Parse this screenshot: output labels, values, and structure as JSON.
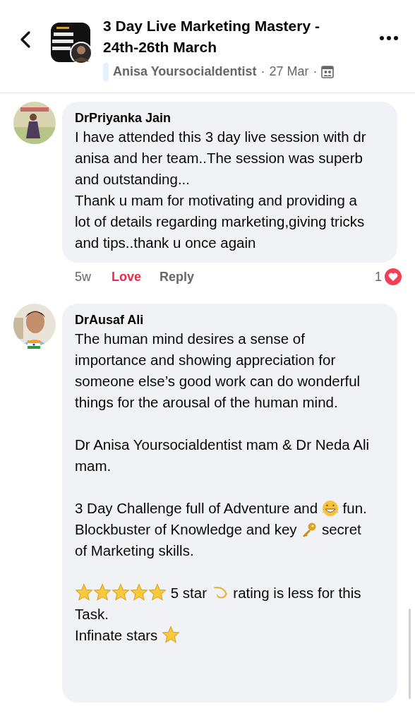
{
  "header": {
    "title": "3 Day Live Marketing Mastery - 24th-26th March",
    "author": "Anisa Yoursocialdentist",
    "date": "27 Mar",
    "separator": "·"
  },
  "comments": [
    {
      "name": "DrPriyanka Jain",
      "blocks": [
        [
          [
            {
              "kind": "text",
              "text": "I have attended this 3 day live session with dr anisa and her team..The session was superb and outstanding..."
            }
          ],
          [
            {
              "kind": "text",
              "text": "Thank u mam for motivating and providing a lot of details regarding marketing,giving tricks and tips..thank u once again"
            }
          ]
        ]
      ],
      "time": "5w",
      "love_label": "Love",
      "reacted": true,
      "reply_label": "Reply",
      "reaction_count": "1"
    },
    {
      "name": "DrAusaf Ali",
      "blocks": [
        [
          [
            {
              "kind": "text",
              "text": "The human mind desires a sense of importance and showing appreciation for someone else’s good work can do wonderful things for the arousal of the human mind."
            }
          ]
        ],
        [
          [
            {
              "kind": "text",
              "text": "Dr Anisa Yoursocialdentist mam & Dr Neda Ali mam."
            }
          ]
        ],
        [
          [
            {
              "kind": "text",
              "text": "3 Day Challenge full of Adventure and "
            },
            {
              "kind": "grin"
            },
            {
              "kind": "text",
              "text": " fun."
            }
          ],
          [
            {
              "kind": "text",
              "text": "Blockbuster of Knowledge and key "
            },
            {
              "kind": "key"
            },
            {
              "kind": "text",
              "text": " secret of Marketing skills."
            }
          ]
        ],
        [
          [
            {
              "kind": "star"
            },
            {
              "kind": "star"
            },
            {
              "kind": "star"
            },
            {
              "kind": "star"
            },
            {
              "kind": "star"
            },
            {
              "kind": "text",
              "text": " 5 star "
            },
            {
              "kind": "comet"
            },
            {
              "kind": "text",
              "text": " rating is less for this Task."
            }
          ],
          [
            {
              "kind": "text",
              "text": "Infinate stars "
            },
            {
              "kind": "star"
            }
          ]
        ]
      ]
    }
  ]
}
